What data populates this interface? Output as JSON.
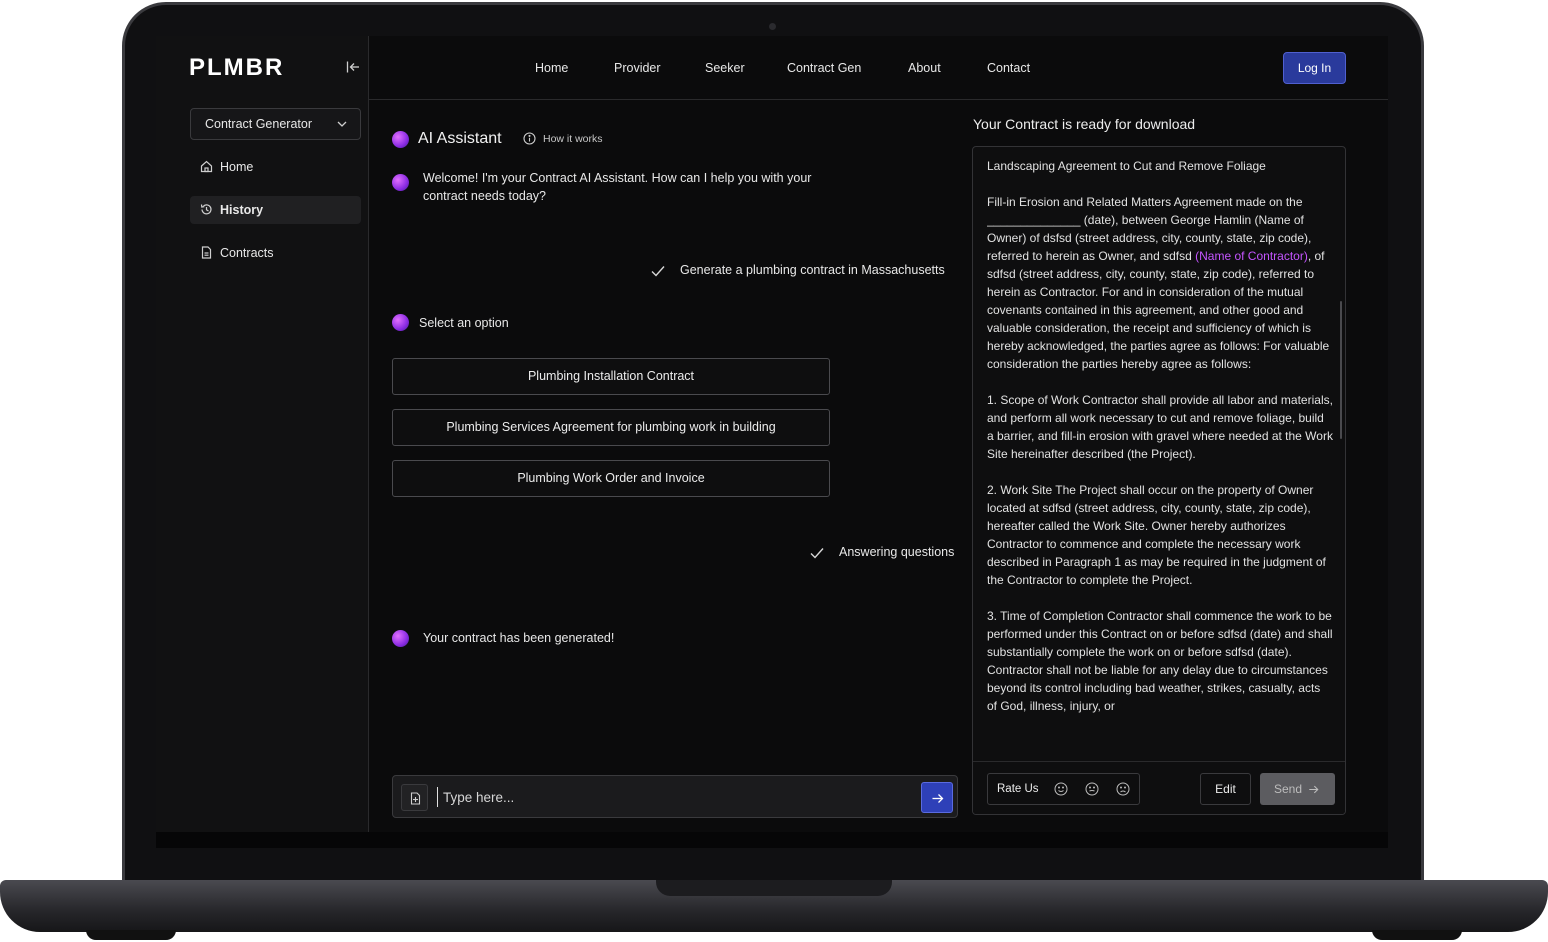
{
  "brand": {
    "logo": "PLMBR"
  },
  "sidebar": {
    "select_label": "Contract Generator",
    "items": [
      {
        "label": "Home",
        "icon": "home-icon"
      },
      {
        "label": "History",
        "icon": "history-icon"
      },
      {
        "label": "Contracts",
        "icon": "document-icon"
      }
    ]
  },
  "topnav": {
    "links": [
      "Home",
      "Provider",
      "Seeker",
      "Contract Gen",
      "About",
      "Contact"
    ],
    "login_label": "Log In"
  },
  "chat": {
    "title": "AI Assistant",
    "how_it_works": "How it works",
    "welcome": "Welcome! I'm your Contract AI Assistant. How can I help you with your contract needs today?",
    "user_request": "Generate a plumbing contract in Massachusetts",
    "select_prompt": "Select an option",
    "options": [
      "Plumbing Installation Contract",
      "Plumbing Services Agreement for plumbing work in building",
      "Plumbing Work Order and Invoice"
    ],
    "answering_status": "Answering questions",
    "generated_message": "Your contract has been generated!",
    "input_placeholder": "Type here..."
  },
  "contract": {
    "heading": "Your Contract is ready for download",
    "title": "Landscaping Agreement to Cut and Remove Foliage",
    "intro_part1": " Fill-in Erosion and Related Matters Agreement made on the ______________ (date), between George Hamlin (Name of Owner) of dsfsd (street address, city, county, state, zip code), referred to herein as Owner, and sdfsd ",
    "intro_highlight": "(Name of Contractor)",
    "intro_part2": ", of sdfsd (street address, city, county, state, zip code), referred to herein as Contractor. For and in consideration of the mutual covenants contained in this agreement, and other good and valuable consideration, the receipt and sufficiency of which is hereby acknowledged, the parties agree as follows: For valuable consideration the parties hereby agree as follows:",
    "section1": "1. Scope of Work Contractor shall provide all labor and materials, and perform all work necessary to cut and remove foliage, build a barrier, and fill-in erosion with gravel where needed at the Work Site hereinafter described (the Project).",
    "section2": "2. Work Site The Project shall occur on the property of Owner located at sdfsd (street address, city, county, state, zip code), hereafter called the Work Site. Owner hereby authorizes Contractor to commence and complete the necessary work described in Paragraph 1 as may be required in the judgment of the Contractor to complete the Project.",
    "section3": "3. Time of Completion Contractor shall commence the work to be performed under this Contract on or before sdfsd (date) and shall substantially complete the work on or before sdfsd (date). Contractor shall not be liable for any delay due to circumstances beyond its control including bad weather, strikes, casualty, acts of God, illness, injury, or",
    "rate_label": "Rate Us",
    "edit_label": "Edit",
    "send_label": "Send"
  },
  "colors": {
    "accent": "#2a3a9c",
    "highlight": "#c455ff",
    "background": "#0b0b0c"
  }
}
